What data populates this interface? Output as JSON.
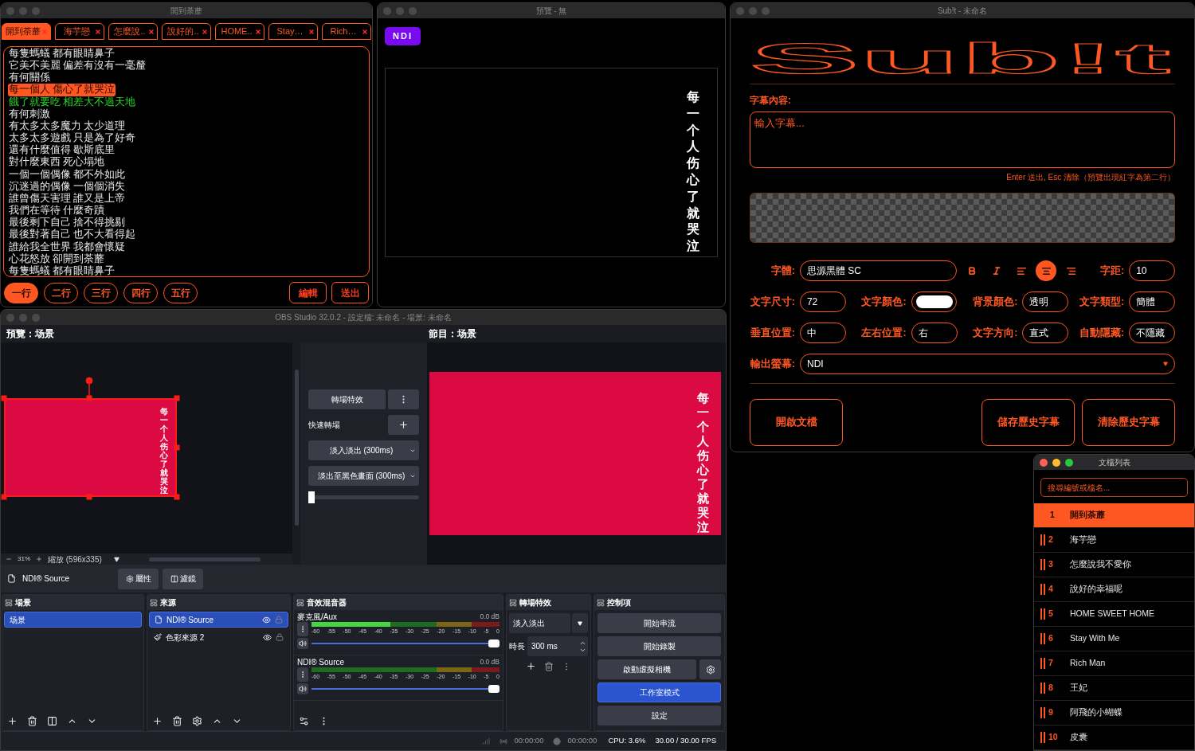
{
  "lyrics": {
    "title": "開到荼蘼",
    "tabs": [
      {
        "label": "開到荼蘼",
        "selected": true
      },
      {
        "label": "海芋戀",
        "selected": false
      },
      {
        "label": "怎麼說..",
        "selected": false
      },
      {
        "label": "說好的..",
        "selected": false
      },
      {
        "label": "HOME..",
        "selected": false
      },
      {
        "label": "Stay…",
        "selected": false
      },
      {
        "label": "Rich…",
        "selected": false
      }
    ],
    "lines": [
      {
        "text": "每隻螞蟻 都有眼睛鼻子",
        "kind": "normal"
      },
      {
        "text": "它美不美麗 偏差有沒有一毫釐",
        "kind": "normal"
      },
      {
        "text": "有何關係",
        "kind": "normal"
      },
      {
        "text": "每一個人 傷心了就哭泣",
        "kind": "current"
      },
      {
        "text": "餓了就要吃 相差大不過天地",
        "kind": "next"
      },
      {
        "text": "有何刺激",
        "kind": "normal"
      },
      {
        "text": "有太多太多魔力 太少道理",
        "kind": "normal"
      },
      {
        "text": "太多太多遊戲 只是為了好奇",
        "kind": "normal"
      },
      {
        "text": "還有什麼值得 歇斯底里",
        "kind": "normal"
      },
      {
        "text": "對什麼東西 死心塌地",
        "kind": "normal"
      },
      {
        "text": "一個一個偶像 都不外如此",
        "kind": "normal"
      },
      {
        "text": "沉迷過的偶像 一個個消失",
        "kind": "normal"
      },
      {
        "text": "誰曾傷天害理 誰又是上帝",
        "kind": "normal"
      },
      {
        "text": "我們在等待 什麼奇蹟",
        "kind": "normal"
      },
      {
        "text": "最後剩下自己 捨不得挑剔",
        "kind": "normal"
      },
      {
        "text": "最後對著自己 也不大看得起",
        "kind": "normal"
      },
      {
        "text": "誰給我全世界 我都會懷疑",
        "kind": "normal"
      },
      {
        "text": "心花怒放 卻開到荼蘼",
        "kind": "normal"
      },
      {
        "text": "每隻螞蟻 都有眼睛鼻子",
        "kind": "normal"
      }
    ],
    "line_buttons": [
      {
        "label": "一行",
        "selected": true
      },
      {
        "label": "二行",
        "selected": false
      },
      {
        "label": "三行",
        "selected": false
      },
      {
        "label": "四行",
        "selected": false
      },
      {
        "label": "五行",
        "selected": false
      }
    ],
    "actions": [
      "編輯",
      "送出"
    ]
  },
  "preview": {
    "title": "預覽 - 無",
    "output_button": "NDI",
    "subtitle": "每一个人伤心了就哭泣"
  },
  "subt": {
    "title": "Sub!t - 未命名",
    "logo": "Sub!t",
    "content": {
      "label": "字幕內容:",
      "placeholder": "輸入字幕..."
    },
    "hint": "Enter 送出, Esc 清除（預覽出現紅字為第二行）",
    "font": {
      "label": "字體:",
      "value": "思源黑體 SC"
    },
    "bold": false,
    "italic": false,
    "align": [
      {
        "kind": "left",
        "selected": false
      },
      {
        "kind": "center",
        "selected": true
      },
      {
        "kind": "right",
        "selected": false
      }
    ],
    "spacing": {
      "label": "字距:",
      "value": "10"
    },
    "settings": [
      [
        {
          "label": "文字尺寸:",
          "kind": "text",
          "value": "72"
        },
        {
          "label": "文字顏色:",
          "kind": "swatch",
          "color": "#ffffff"
        },
        {
          "label": "背景顏色:",
          "kind": "text",
          "value": "透明"
        },
        {
          "label": "文字類型:",
          "kind": "text",
          "value": "簡體"
        }
      ],
      [
        {
          "label": "垂直位置:",
          "kind": "text",
          "value": "中"
        },
        {
          "label": "左右位置:",
          "kind": "text",
          "value": "右"
        },
        {
          "label": "文字方向:",
          "kind": "text",
          "value": "直式"
        },
        {
          "label": "自動隱藏:",
          "kind": "text",
          "value": "不隱藏"
        }
      ]
    ],
    "output": {
      "label": "輸出螢幕:",
      "value": "NDI"
    },
    "buttons": [
      "開啟文檔",
      "儲存歷史字幕",
      "清除歷史字幕"
    ]
  },
  "obs": {
    "title": "OBS Studio 32.0.2 - 設定檔: 未命名 - 場景: 未命名",
    "preview_label": "預覽：场景",
    "program_label": "節目：场景",
    "preview_subtitle": "每一个人伤心了就哭泣",
    "program_subtitle": "每一个人伤心了就哭泣",
    "zoom": {
      "percent": "31%",
      "mode": "縮放 (596x335)"
    },
    "transition": {
      "button": "轉場特效",
      "quick_label": "快速轉場",
      "options": [
        "淡入淡出 (300ms)",
        "淡出至黑色畫面 (300ms)"
      ],
      "tbar": {
        "level": 0
      }
    },
    "source_toolbar": {
      "source": "NDI® Source",
      "properties": "屬性",
      "filters": "濾鏡"
    },
    "scenes": {
      "title": "場景",
      "items": [
        {
          "label": "场景",
          "selected": true
        }
      ]
    },
    "sources": {
      "title": "來源",
      "items": [
        {
          "label": "NDI® Source",
          "kind": "file",
          "selected": true
        },
        {
          "label": "色彩來源 2",
          "kind": "color",
          "selected": false
        }
      ]
    },
    "mixer": {
      "title": "音效混音器",
      "channels": [
        {
          "name": "麥克風/Aux",
          "reading": "0.0 dB",
          "meter": {
            "level": 0.42
          },
          "fader": {
            "level": 1
          },
          "scale": [
            "-60",
            "-55",
            "-50",
            "-45",
            "-40",
            "-35",
            "-30",
            "-25",
            "-20",
            "-15",
            "-10",
            "-5",
            "0"
          ]
        },
        {
          "name": "NDI® Source",
          "reading": "0.0 dB",
          "meter": {
            "level": 0
          },
          "fader": {
            "level": 1
          },
          "scale": [
            "-60",
            "-55",
            "-50",
            "-45",
            "-40",
            "-35",
            "-30",
            "-25",
            "-20",
            "-15",
            "-10",
            "-5",
            "0"
          ]
        }
      ]
    },
    "transitions": {
      "title": "轉場特效",
      "transition": "淡入淡出",
      "duration_label": "時長",
      "duration": "300 ms"
    },
    "controls": {
      "title": "控制項",
      "buttons": [
        {
          "label": "開始串流",
          "kind": "plain",
          "on": false
        },
        {
          "label": "開始錄製",
          "kind": "plain",
          "on": false
        },
        {
          "label": "啟動虛擬相機",
          "kind": "with_settings",
          "on": false
        },
        {
          "label": "工作室模式",
          "kind": "plain",
          "on": true
        },
        {
          "label": "設定",
          "kind": "plain",
          "on": false
        }
      ]
    },
    "status": {
      "stream_time": "00:00:00",
      "record_time": "00:00:00",
      "cpu": "CPU: 3.6%",
      "fps": "30.00 / 30.00 FPS"
    }
  },
  "files": {
    "title": "文檔列表",
    "search_placeholder": "搜尋編號或檔名...",
    "items": [
      {
        "number": "1",
        "name": "開到荼蘼",
        "selected": true
      },
      {
        "number": "2",
        "name": "海芋戀",
        "selected": false
      },
      {
        "number": "3",
        "name": "怎麼說我不愛你",
        "selected": false
      },
      {
        "number": "4",
        "name": "說好的幸福呢",
        "selected": false
      },
      {
        "number": "5",
        "name": "HOME SWEET HOME",
        "selected": false
      },
      {
        "number": "6",
        "name": "Stay With Me",
        "selected": false
      },
      {
        "number": "7",
        "name": "Rich Man",
        "selected": false
      },
      {
        "number": "8",
        "name": "王妃",
        "selected": false
      },
      {
        "number": "9",
        "name": "阿飛的小蝴蝶",
        "selected": false
      },
      {
        "number": "10",
        "name": "皮囊",
        "selected": false
      }
    ]
  }
}
